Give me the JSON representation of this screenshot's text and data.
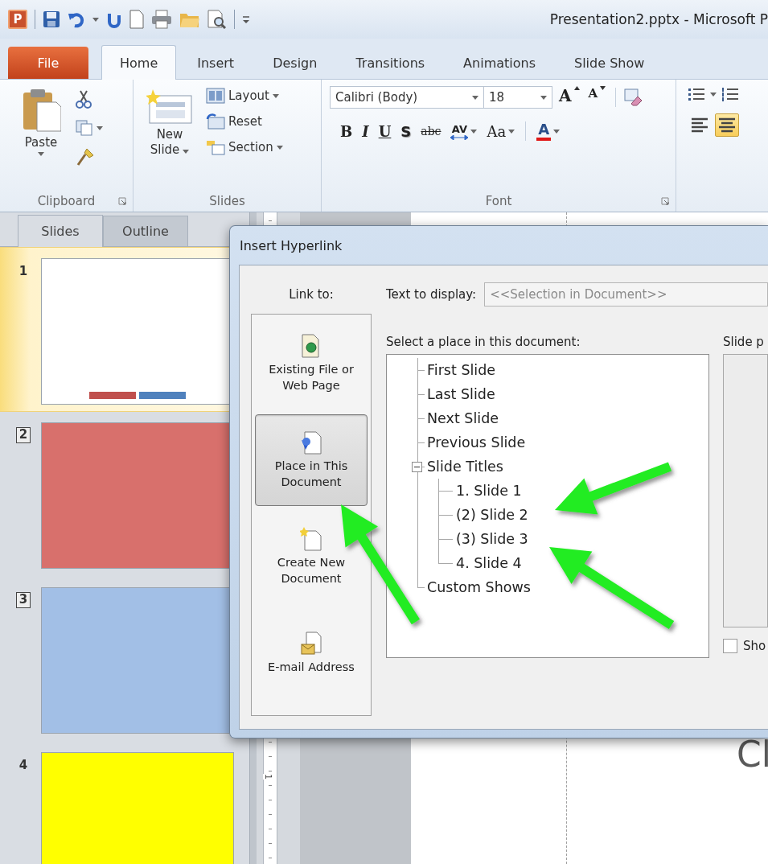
{
  "window": {
    "app_icon": "P",
    "title": "Presentation2.pptx - Microsoft P"
  },
  "ribbon_tabs": [
    {
      "label": "File",
      "kind": "backstage",
      "selected": false
    },
    {
      "label": "Home",
      "kind": "tab",
      "selected": true
    },
    {
      "label": "Insert",
      "kind": "tab",
      "selected": false
    },
    {
      "label": "Design",
      "kind": "tab",
      "selected": false
    },
    {
      "label": "Transitions",
      "kind": "tab",
      "selected": false
    },
    {
      "label": "Animations",
      "kind": "tab",
      "selected": false
    },
    {
      "label": "Slide Show",
      "kind": "tab",
      "selected": false
    }
  ],
  "ribbon": {
    "clipboard": {
      "label": "Clipboard",
      "paste": "Paste"
    },
    "slides": {
      "label": "Slides",
      "new_slide": "New Slide",
      "layout": "Layout",
      "reset": "Reset",
      "section": "Section"
    },
    "font": {
      "label": "Font",
      "font_name": "Calibri (Body)",
      "font_size": "18",
      "size_buttons": [
        {
          "label": "A",
          "kind": "grow"
        },
        {
          "label": "A",
          "kind": "shrink"
        }
      ],
      "format_buttons": [
        {
          "label": "B",
          "kind": "bold"
        },
        {
          "label": "I",
          "kind": "italic"
        },
        {
          "label": "U",
          "kind": "underline"
        },
        {
          "label": "S",
          "kind": "shadow"
        },
        {
          "label": "abc",
          "kind": "strike"
        },
        {
          "label": "AV",
          "kind": "spacing"
        },
        {
          "label": "Aa",
          "kind": "case"
        },
        {
          "label": "A",
          "kind": "color"
        }
      ]
    },
    "paragraph": {
      "align_buttons": [
        {
          "kind": "left",
          "selected": false
        },
        {
          "kind": "center",
          "selected": true
        }
      ]
    }
  },
  "slides_pane": {
    "tabs": [
      {
        "label": "Slides",
        "selected": true
      },
      {
        "label": "Outline",
        "selected": false
      }
    ],
    "slides": [
      {
        "number": "1",
        "hidden": false,
        "selected": true,
        "color": "#ffffff",
        "shapes": [
          {
            "color": "#c0504d"
          },
          {
            "color": "#4f81bd"
          }
        ]
      },
      {
        "number": "2",
        "hidden": true,
        "selected": false,
        "color": "#d8706c"
      },
      {
        "number": "3",
        "hidden": true,
        "selected": false,
        "color": "#a2bfe6"
      },
      {
        "number": "4",
        "hidden": false,
        "selected": false,
        "color": "#ffff00"
      }
    ]
  },
  "editor": {
    "ruler_label": "1",
    "slide_text": "Cl"
  },
  "dialog": {
    "title": "Insert Hyperlink",
    "link_to_label": "Link to:",
    "link_targets": [
      {
        "label": "Existing File or Web Page",
        "kind": "file",
        "selected": false
      },
      {
        "label": "Place in This Document",
        "kind": "place",
        "selected": true
      },
      {
        "label": "Create New Document",
        "kind": "new",
        "selected": false
      },
      {
        "label": "E-mail Address",
        "kind": "email",
        "selected": false
      }
    ],
    "text_to_display": {
      "label": "Text to display:",
      "value": "<<Selection in Document>>",
      "disabled": true
    },
    "place_label": "Select a place in this document:",
    "tree": [
      {
        "label": "First Slide"
      },
      {
        "label": "Last Slide"
      },
      {
        "label": "Next Slide"
      },
      {
        "label": "Previous Slide"
      },
      {
        "label": "Slide Titles",
        "expanded": true,
        "children": [
          {
            "label": "1. Slide 1"
          },
          {
            "label": "(2) Slide 2"
          },
          {
            "label": "(3) Slide 3"
          },
          {
            "label": "4. Slide 4"
          }
        ]
      },
      {
        "label": "Custom Shows"
      }
    ],
    "preview_label": "Slide p",
    "show_checkbox": {
      "label": "Sho",
      "checked": false
    }
  }
}
